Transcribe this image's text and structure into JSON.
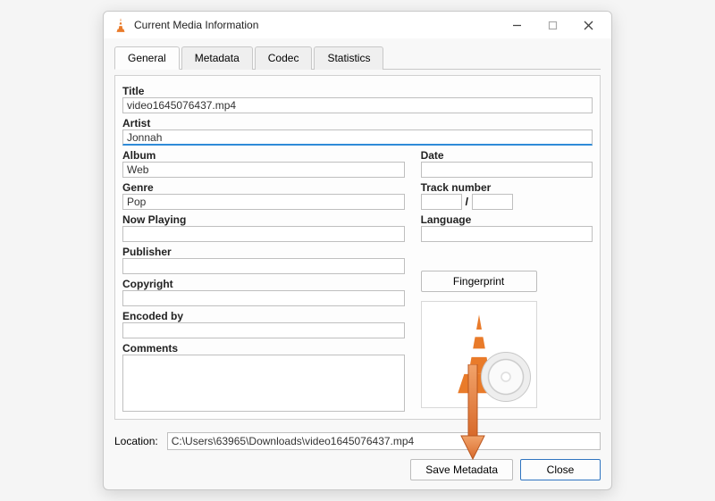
{
  "window": {
    "title": "Current Media Information"
  },
  "tabs": {
    "general": "General",
    "metadata": "Metadata",
    "codec": "Codec",
    "statistics": "Statistics",
    "active": "general"
  },
  "fields": {
    "title_label": "Title",
    "title_value": "video1645076437.mp4",
    "artist_label": "Artist",
    "artist_value": "Jonnah",
    "album_label": "Album",
    "album_value": "Web",
    "date_label": "Date",
    "date_value": "",
    "genre_label": "Genre",
    "genre_value": "Pop",
    "track_label": "Track number",
    "track_value": "",
    "track_total": "",
    "track_sep": "/",
    "nowplaying_label": "Now Playing",
    "nowplaying_value": "",
    "language_label": "Language",
    "language_value": "",
    "publisher_label": "Publisher",
    "publisher_value": "",
    "copyright_label": "Copyright",
    "copyright_value": "",
    "encodedby_label": "Encoded by",
    "encodedby_value": "",
    "comments_label": "Comments",
    "comments_value": ""
  },
  "buttons": {
    "fingerprint": "Fingerprint",
    "save_metadata": "Save Metadata",
    "close": "Close"
  },
  "location": {
    "label": "Location:",
    "value": "C:\\Users\\63965\\Downloads\\video1645076437.mp4"
  }
}
